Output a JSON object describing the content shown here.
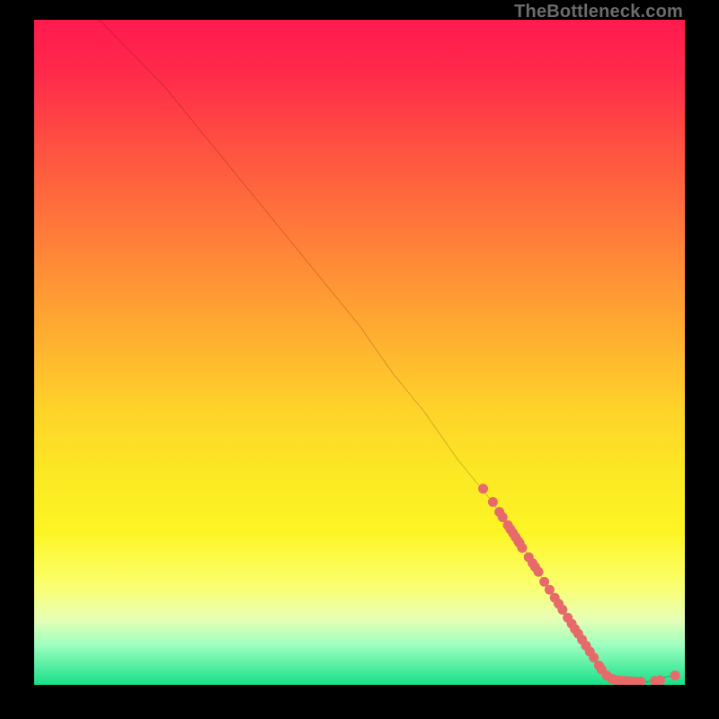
{
  "watermark": "TheBottleneck.com",
  "chart_data": {
    "type": "line",
    "title": "",
    "xlabel": "",
    "ylabel": "",
    "xlim": [
      0,
      100
    ],
    "ylim": [
      0,
      100
    ],
    "grid": false,
    "legend": false,
    "curve": {
      "x": [
        10,
        12,
        16,
        20,
        25,
        30,
        35,
        40,
        45,
        50,
        55,
        60,
        65,
        70,
        75,
        80,
        83,
        86,
        90,
        94,
        98
      ],
      "y": [
        100,
        98,
        94,
        90,
        84,
        78,
        72,
        66,
        60,
        54,
        47,
        41,
        34,
        28,
        21,
        13,
        8,
        3.5,
        0.6,
        0.4,
        1.4
      ]
    },
    "scatter": {
      "x": [
        69,
        70.5,
        71.5,
        72,
        72.8,
        73.2,
        73.6,
        74,
        74.4,
        74.6,
        75,
        76,
        76.6,
        77,
        77.5,
        78.4,
        79.2,
        80,
        80.6,
        81.2,
        82,
        82.6,
        83.1,
        83.6,
        84.2,
        84.8,
        85.4,
        86,
        86.8,
        87.2,
        88,
        88.8,
        89.5,
        90.2,
        91,
        91.8,
        92.4,
        93.2,
        95.4,
        96.2,
        98.5
      ],
      "y": [
        29.5,
        27.5,
        26,
        25.2,
        24,
        23.4,
        22.8,
        22.2,
        21.6,
        21.3,
        20.6,
        19.2,
        18.3,
        17.7,
        17,
        15.5,
        14.3,
        13.1,
        12.2,
        11.3,
        10.1,
        9.2,
        8.4,
        7.7,
        6.8,
        5.9,
        5,
        4.1,
        2.9,
        2.3,
        1.4,
        0.9,
        0.7,
        0.65,
        0.6,
        0.55,
        0.5,
        0.5,
        0.6,
        0.7,
        1.4
      ]
    },
    "scatter_color": "#e76a6a",
    "curve_color": "#000000"
  }
}
